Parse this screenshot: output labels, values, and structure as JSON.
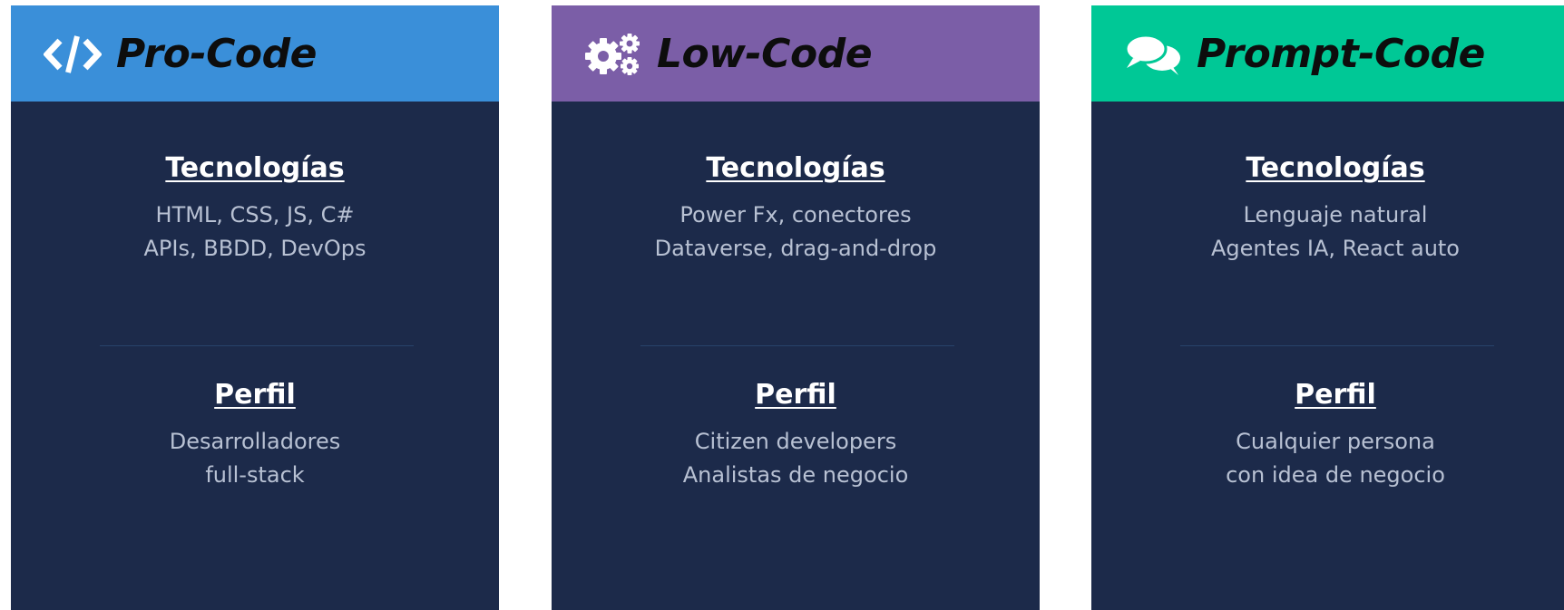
{
  "colors": {
    "card_body": "#1c2a4a",
    "pro_header": "#3a8fd9",
    "low_header": "#7b5ea7",
    "prompt_header": "#00c896",
    "heading_text": "#ffffff",
    "body_text": "#b8c1d3",
    "divider": "#27436a"
  },
  "cards": [
    {
      "title": "Pro-Code",
      "icon": "code-icon",
      "header_color": "#3a8fd9",
      "tech_heading": "Tecnologías",
      "tech_line1": "HTML, CSS, JS, C#",
      "tech_line2": "APIs, BBDD, DevOps",
      "profile_heading": "Perfil",
      "profile_line1": "Desarrolladores",
      "profile_line2": "full-stack"
    },
    {
      "title": "Low-Code",
      "icon": "gears-icon",
      "header_color": "#7b5ea7",
      "tech_heading": "Tecnologías",
      "tech_line1": "Power Fx, conectores",
      "tech_line2": "Dataverse, drag-and-drop",
      "profile_heading": "Perfil",
      "profile_line1": "Citizen developers",
      "profile_line2": "Analistas de negocio"
    },
    {
      "title": "Prompt-Code",
      "icon": "chat-bubbles-icon",
      "header_color": "#00c896",
      "tech_heading": "Tecnologías",
      "tech_line1": "Lenguaje natural",
      "tech_line2": "Agentes IA, React auto",
      "profile_heading": "Perfil",
      "profile_line1": "Cualquier persona",
      "profile_line2": "con idea de negocio"
    }
  ]
}
